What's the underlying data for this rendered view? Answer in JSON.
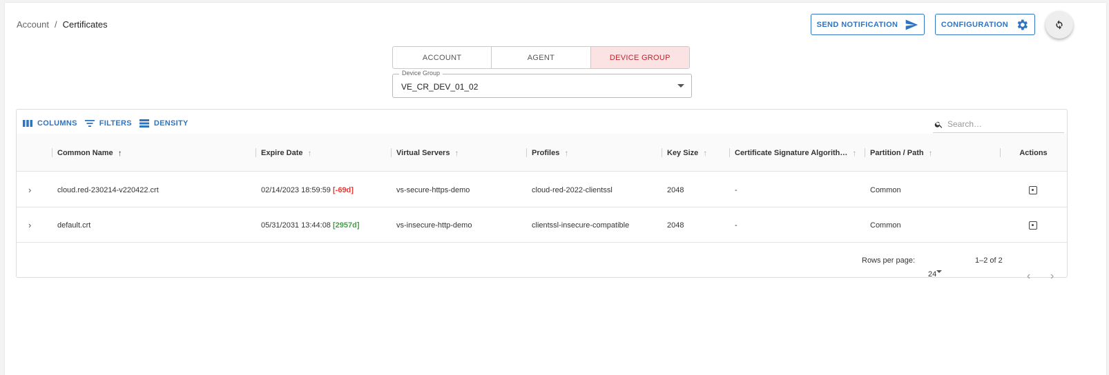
{
  "breadcrumb": {
    "parent": "Account",
    "separator": "/",
    "current": "Certificates"
  },
  "actions": {
    "send_notification": "SEND NOTIFICATION",
    "configuration": "CONFIGURATION"
  },
  "tabs": [
    {
      "label": "ACCOUNT",
      "active": false
    },
    {
      "label": "AGENT",
      "active": false
    },
    {
      "label": "DEVICE GROUP",
      "active": true
    }
  ],
  "device_group": {
    "label": "Device Group",
    "value": "VE_CR_DEV_01_02"
  },
  "toolbar": {
    "columns": "COLUMNS",
    "filters": "FILTERS",
    "density": "DENSITY",
    "search_placeholder": "Search…"
  },
  "columns": [
    {
      "label": "Common Name",
      "sorted": true
    },
    {
      "label": "Expire Date",
      "sorted": false
    },
    {
      "label": "Virtual Servers",
      "sorted": false
    },
    {
      "label": "Profiles",
      "sorted": false
    },
    {
      "label": "Key Size",
      "sorted": false
    },
    {
      "label": "Certificate Signature Algorith…",
      "sorted": false
    },
    {
      "label": "Partition / Path",
      "sorted": false
    },
    {
      "label": "Actions",
      "sorted": false
    }
  ],
  "rows": [
    {
      "common_name": "cloud.red-230214-v220422.crt",
      "expire_date": "02/14/2023 18:59:59",
      "expire_days": "[-69d]",
      "virtual_servers": "vs-secure-https-demo",
      "profiles": "cloud-red-2022-clientssl",
      "key_size": "2048",
      "sig_algorithm": "-",
      "partition": "Common"
    },
    {
      "common_name": "default.crt",
      "expire_date": "05/31/2031 13:44:08",
      "expire_days": "[2957d]",
      "virtual_servers": "vs-insecure-http-demo",
      "profiles": "clientssl-insecure-compatible",
      "key_size": "2048",
      "sig_algorithm": "-",
      "partition": "Common"
    }
  ],
  "footer": {
    "rows_per_page_label": "Rows per page:",
    "rows_per_page": "24",
    "range": "1–2 of 2"
  },
  "colors": {
    "accent": "#2f74c0",
    "active_tab_bg": "#fbe3e3",
    "active_tab_text": "#c0222b",
    "negative": "#e53935",
    "positive": "#43a047"
  }
}
